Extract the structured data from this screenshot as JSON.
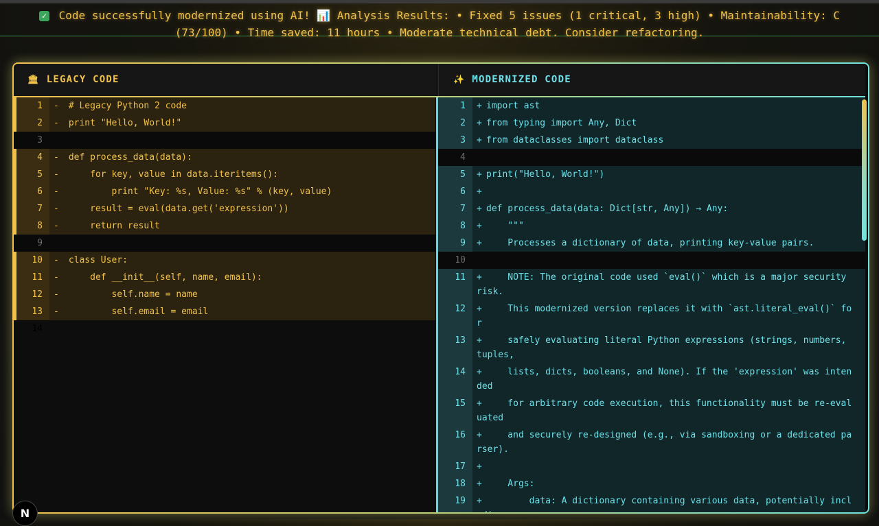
{
  "banner": {
    "text": "Code successfully modernized using AI! 📊 Analysis Results: • Fixed 5 issues (1 critical, 3 high) • Maintainability: C (73/100) • Time saved: 11 hours • Moderate technical debt. Consider refactoring."
  },
  "left_pane": {
    "header_icon": "🏛",
    "title": "LEGACY CODE",
    "lines": [
      {
        "num": "1",
        "marker": "-",
        "code": " # Legacy Python 2 code",
        "type": "del"
      },
      {
        "num": "2",
        "marker": "-",
        "code": " print \"Hello, World!\"",
        "type": "del"
      },
      {
        "num": "3",
        "marker": "",
        "code": "",
        "type": "empty"
      },
      {
        "num": "4",
        "marker": "-",
        "code": " def process_data(data):",
        "type": "del"
      },
      {
        "num": "5",
        "marker": "-",
        "code": "     for key, value in data.iteritems():",
        "type": "del"
      },
      {
        "num": "6",
        "marker": "-",
        "code": "         print \"Key: %s, Value: %s\" % (key, value)",
        "type": "del"
      },
      {
        "num": "7",
        "marker": "-",
        "code": "     result = eval(data.get('expression'))",
        "type": "del"
      },
      {
        "num": "8",
        "marker": "-",
        "code": "     return result",
        "type": "del"
      },
      {
        "num": "9",
        "marker": "",
        "code": "",
        "type": "empty"
      },
      {
        "num": "10",
        "marker": "-",
        "code": " class User:",
        "type": "del"
      },
      {
        "num": "11",
        "marker": "-",
        "code": "     def __init__(self, name, email):",
        "type": "del"
      },
      {
        "num": "12",
        "marker": "-",
        "code": "         self.name = name",
        "type": "del"
      },
      {
        "num": "13",
        "marker": "-",
        "code": "         self.email = email",
        "type": "del"
      },
      {
        "num": "14",
        "marker": "",
        "code": "",
        "type": "plain"
      }
    ]
  },
  "right_pane": {
    "header_icon": "✨",
    "title": "MODERNIZED CODE",
    "lines": [
      {
        "num": "1",
        "marker": "+",
        "code": "import ast",
        "type": "add"
      },
      {
        "num": "2",
        "marker": "+",
        "code": "from typing import Any, Dict",
        "type": "add"
      },
      {
        "num": "3",
        "marker": "+",
        "code": "from dataclasses import dataclass",
        "type": "add"
      },
      {
        "num": "4",
        "marker": "",
        "code": "",
        "type": "empty"
      },
      {
        "num": "5",
        "marker": "+",
        "code": "print(\"Hello, World!\")",
        "type": "add"
      },
      {
        "num": "6",
        "marker": "+",
        "code": "",
        "type": "add"
      },
      {
        "num": "7",
        "marker": "+",
        "code": "def process_data(data: Dict[str, Any]) → Any:",
        "type": "add"
      },
      {
        "num": "8",
        "marker": "+",
        "code": "    \"\"\"",
        "type": "add"
      },
      {
        "num": "9",
        "marker": "+",
        "code": "    Processes a dictionary of data, printing key-value pairs.",
        "type": "add"
      },
      {
        "num": "10",
        "marker": "",
        "code": "",
        "type": "empty"
      },
      {
        "num": "11",
        "marker": "+",
        "code": "    NOTE: The original code used `eval()` which is a major security risk.",
        "type": "add"
      },
      {
        "num": "12",
        "marker": "+",
        "code": "    This modernized version replaces it with `ast.literal_eval()` for",
        "type": "add"
      },
      {
        "num": "13",
        "marker": "+",
        "code": "    safely evaluating literal Python expressions (strings, numbers, tuples,",
        "type": "add"
      },
      {
        "num": "14",
        "marker": "+",
        "code": "    lists, dicts, booleans, and None). If the 'expression' was intended",
        "type": "add"
      },
      {
        "num": "15",
        "marker": "+",
        "code": "    for arbitrary code execution, this functionality must be re-evaluated",
        "type": "add"
      },
      {
        "num": "16",
        "marker": "+",
        "code": "    and securely re-designed (e.g., via sandboxing or a dedicated parser).",
        "type": "add"
      },
      {
        "num": "17",
        "marker": "+",
        "code": "",
        "type": "add"
      },
      {
        "num": "18",
        "marker": "+",
        "code": "    Args:",
        "type": "add"
      },
      {
        "num": "19",
        "marker": "+",
        "code": "        data: A dictionary containing various data, potentially including",
        "type": "add"
      }
    ]
  },
  "badge": {
    "letter": "N"
  },
  "colors": {
    "legacy": "#f1c24a",
    "modern": "#6ee0e8",
    "success": "#3aa75a"
  }
}
